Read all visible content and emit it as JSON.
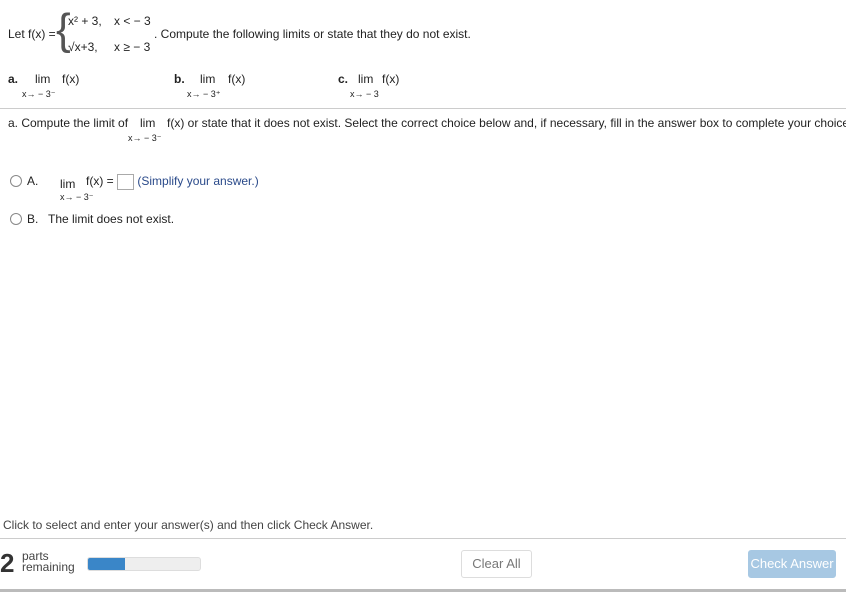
{
  "problem": {
    "let": "Let f(x) =",
    "piece1_expr": "x² + 3,",
    "piece1_cond": "x < − 3",
    "piece2_expr": "√x+3,",
    "piece2_cond": "x ≥ − 3",
    "instruction": ". Compute the following limits or state that they do not exist."
  },
  "parts": [
    {
      "letter": "a.",
      "lim": "lim",
      "fn": "f(x)",
      "approach": "x→ − 3⁻"
    },
    {
      "letter": "b.",
      "lim": "lim",
      "fn": "f(x)",
      "approach": "x→ − 3⁺"
    },
    {
      "letter": "c.",
      "lim": "lim",
      "fn": "f(x)",
      "approach": "x→ − 3"
    }
  ],
  "question": {
    "prefix": "a. Compute the limit of",
    "lim": "lim",
    "approach": "x→ − 3⁻",
    "suffix": "f(x) or state that it does not exist. Select the correct choice below and, if necessary, fill in the answer box to complete your choice."
  },
  "choices": [
    {
      "letter": "A.",
      "lim": "lim",
      "fn": "f(x) =",
      "approach": "x→ − 3⁻",
      "hint": "(Simplify your answer.)",
      "selected": false
    },
    {
      "letter": "B.",
      "text": "The limit does not exist.",
      "selected": false
    }
  ],
  "footer": {
    "instruction": "Click to select and enter your answer(s) and then click Check Answer.",
    "parts_count": "2",
    "parts_label1": "parts",
    "parts_label2": "remaining",
    "progress_percent": 33,
    "clear_all": "Clear All",
    "check_answer": "Check Answer",
    "accent": "#3a86c8"
  }
}
